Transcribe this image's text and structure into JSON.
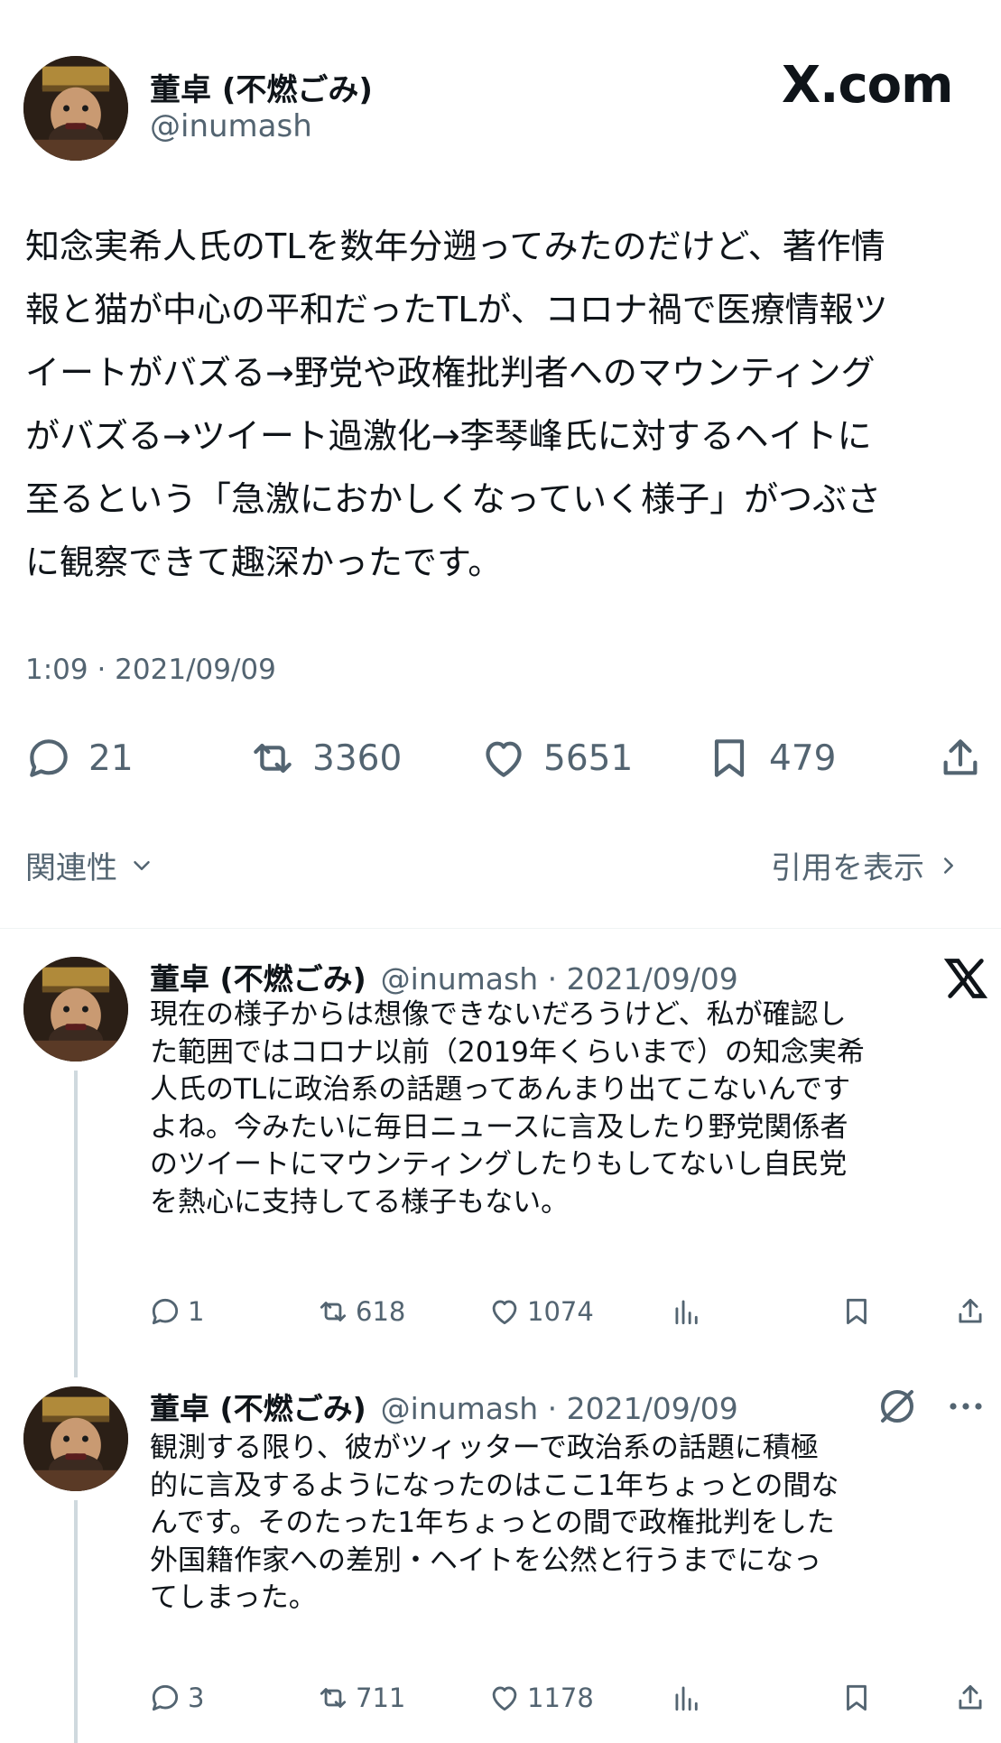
{
  "main_tweet": {
    "name": "董卓 (不燃ごみ)",
    "handle": "@inumash",
    "brand": "X.com",
    "text": "知念実希人氏のTLを数年分遡ってみたのだけど、著作情\n報と猫が中心の平和だったTLが、コロナ禍で医療情報ツ\nイートがバズる→野党や政権批判者へのマウンティング\nがバズる→ツイート過激化→李琴峰氏に対するヘイトに\n至るという「急激におかしくなっていく様子」がつぶさ\nに観察できて趣深かったです。",
    "timestamp": "1:09 · 2021/09/09",
    "stats": {
      "replies": "21",
      "retweets": "3360",
      "likes": "5651",
      "bookmarks": "479"
    }
  },
  "sort_row": {
    "relevance": "関連性",
    "quotes": "引用を表示"
  },
  "replies": [
    {
      "name": "董卓 (不燃ごみ)",
      "meta": "@inumash · 2021/09/09",
      "text": "現在の様子からは想像できないだろうけど、私が確認し\nた範囲ではコロナ以前（2019年くらいまで）の知念実希\n人氏のTLに政治系の話題ってあんまり出てこないんです\nよね。今みたいに毎日ニュースに言及したり野党関係者\nのツイートにマウンティングしたりもしてないし自民党\nを熱心に支持してる様子もない。",
      "stats": {
        "replies": "1",
        "retweets": "618",
        "likes": "1074"
      }
    },
    {
      "name": "董卓 (不燃ごみ)",
      "meta": "@inumash · 2021/09/09",
      "text": "観測する限り、彼がツィッターで政治系の話題に積極\n的に言及するようになったのはここ1年ちょっとの間な\nんです。そのたった1年ちょっとの間で政権批判をした\n外国籍作家への差別・ヘイトを公然と行うまでになっ\nてしまった。",
      "stats": {
        "replies": "3",
        "retweets": "711",
        "likes": "1178"
      }
    }
  ],
  "icons": [
    "reply-icon",
    "retweet-icon",
    "like-icon",
    "bookmark-icon",
    "share-icon",
    "views-icon",
    "x-logo-icon",
    "grok-icon",
    "more-icon",
    "chevron-down-icon",
    "chevron-right-icon"
  ]
}
